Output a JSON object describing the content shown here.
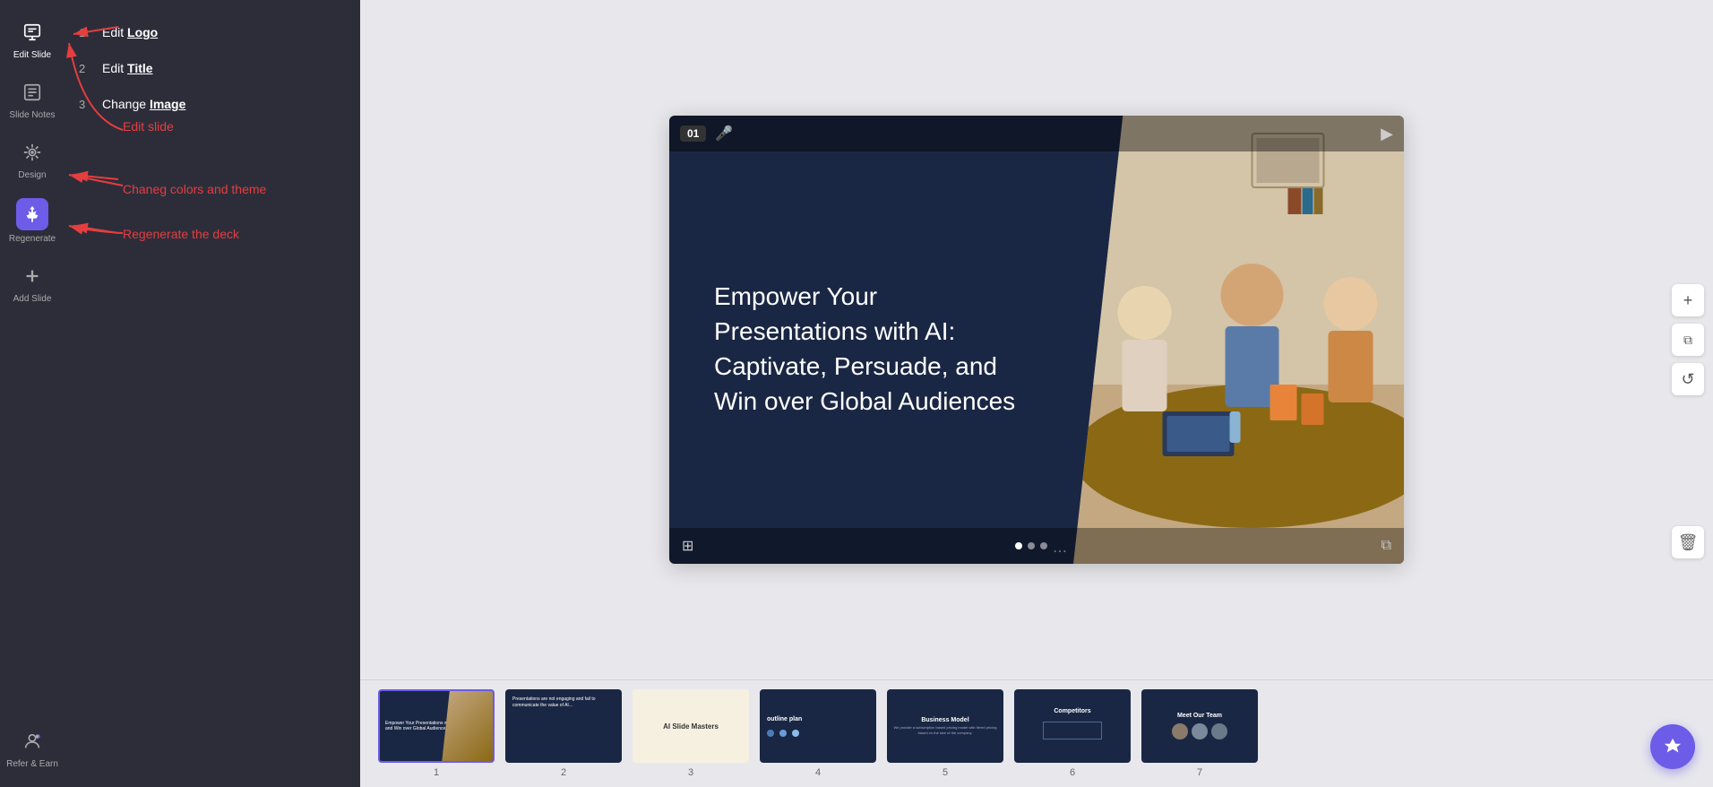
{
  "sidebar": {
    "items": [
      {
        "id": "edit-slide",
        "label": "Edit Slide",
        "icon": "edit-slide-icon",
        "active": true
      },
      {
        "id": "slide-notes",
        "label": "Slide Notes",
        "icon": "slide-notes-icon",
        "active": false
      },
      {
        "id": "design",
        "label": "Design",
        "icon": "design-icon",
        "active": false
      },
      {
        "id": "regenerate",
        "label": "Regenerate",
        "icon": "regenerate-icon",
        "active": false
      },
      {
        "id": "add-slide",
        "label": "Add Slide",
        "icon": "add-slide-icon",
        "active": false
      }
    ],
    "bottom": {
      "id": "refer-earn",
      "label": "Refer & Earn",
      "icon": "refer-icon"
    }
  },
  "annotations": [
    {
      "num": "1",
      "prefix": "Edit ",
      "underline": "Logo"
    },
    {
      "num": "2",
      "prefix": "Edit ",
      "underline": "Title"
    },
    {
      "num": "3",
      "prefix": "Change ",
      "underline": "Image"
    }
  ],
  "red_labels": [
    "Edit slide",
    "Chaneg colors and theme",
    "Regenerate the deck"
  ],
  "slide": {
    "number": "01",
    "title": "Empower Your Presentations with AI: Captivate, Persuade, and Win over Global Audiences",
    "dots": [
      {
        "active": true
      },
      {
        "active": false
      },
      {
        "active": false
      },
      {
        "active": false
      }
    ]
  },
  "thumbnails": [
    {
      "num": "1",
      "active": true,
      "bg": "#1a2744",
      "text": "Empower Your Presentations with AI: Captivate, and Win over Global Audiences"
    },
    {
      "num": "2",
      "active": false,
      "bg": "#1a2744",
      "text": "Presentations are not engaging and fail to communicate the value of AI..."
    },
    {
      "num": "3",
      "active": false,
      "bg": "#f5f0e0",
      "text": "AI Slide Masters",
      "textColor": "#333"
    },
    {
      "num": "4",
      "active": false,
      "bg": "#1a2744",
      "text": "Outline plan"
    },
    {
      "num": "5",
      "active": false,
      "bg": "#1a2744",
      "text": "Business Model"
    },
    {
      "num": "6",
      "active": false,
      "bg": "#1a2744",
      "text": "Competitors"
    },
    {
      "num": "7",
      "active": false,
      "bg": "#1a2744",
      "text": "Meet Our Team"
    }
  ],
  "tools": {
    "add": "+",
    "copy": "⧉",
    "undo": "↺",
    "delete": "🗑"
  },
  "colors": {
    "sidebar_bg": "#2d2d3a",
    "accent_purple": "#6c5ce7",
    "slide_bg": "#1a2744",
    "red_annotation": "#e53e3e",
    "body_bg": "#e8e8ec"
  }
}
